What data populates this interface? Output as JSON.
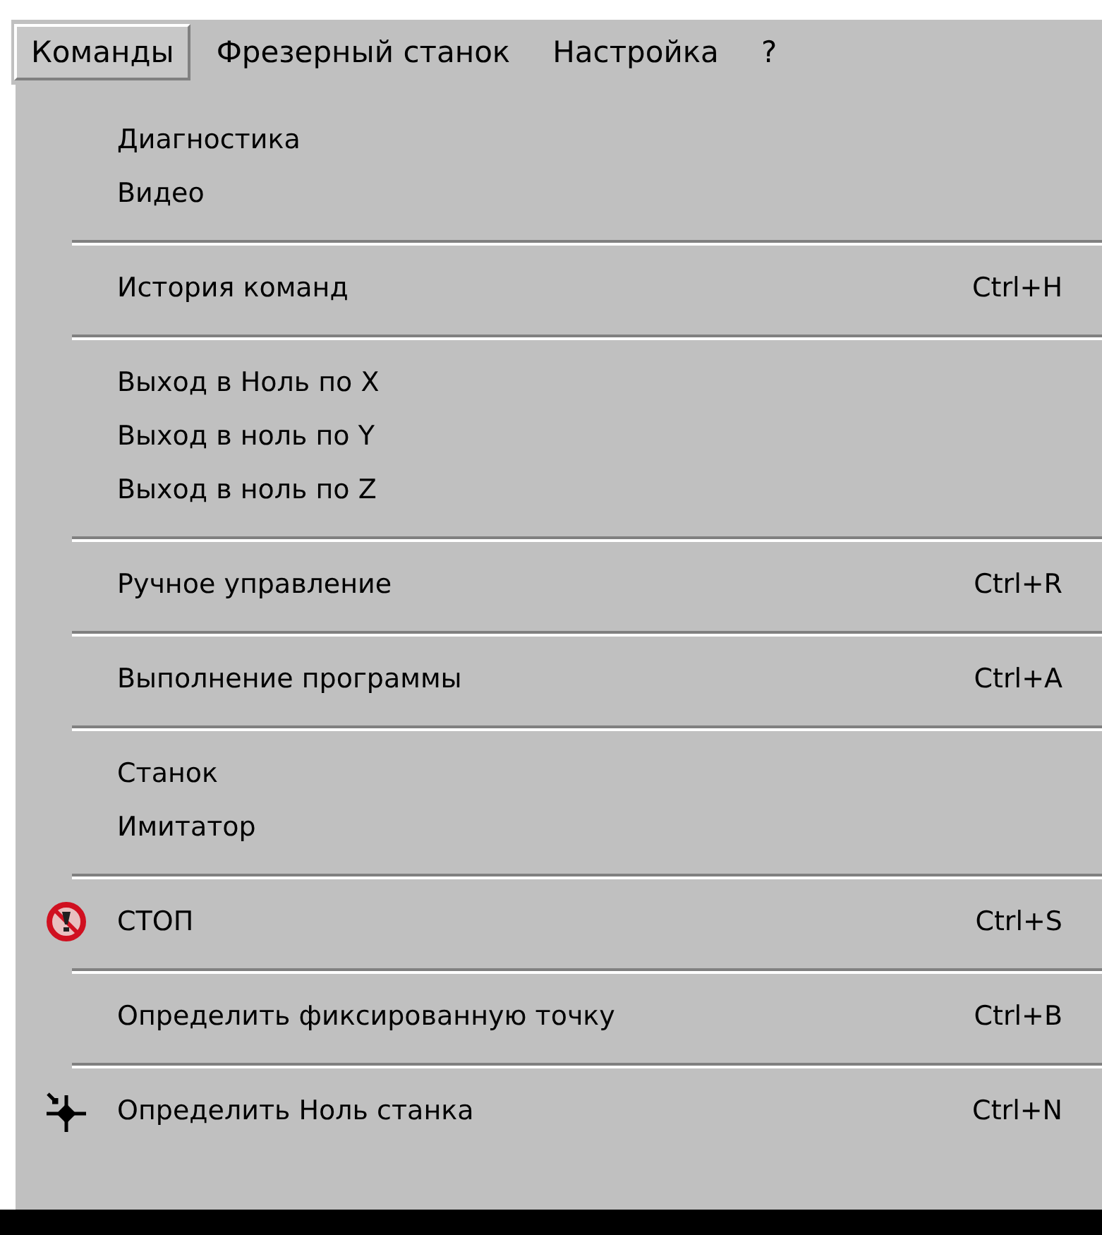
{
  "menubar": [
    {
      "label": "Команды",
      "selected": true
    },
    {
      "label": "Фрезерный станок",
      "selected": false
    },
    {
      "label": "Настройка",
      "selected": false
    },
    {
      "label": "?",
      "selected": false
    }
  ],
  "menu": {
    "groups": [
      [
        {
          "kind": "plain",
          "label": "Диагностика"
        },
        {
          "kind": "plain",
          "label": "Видео"
        }
      ],
      [
        {
          "kind": "plain",
          "label": "История команд",
          "shortcut": "Ctrl+H"
        }
      ],
      [
        {
          "kind": "plain",
          "label": "Выход в Ноль по X"
        },
        {
          "kind": "plain",
          "label": "Выход в ноль по Y"
        },
        {
          "kind": "plain",
          "label": "Выход в ноль по Z"
        }
      ],
      [
        {
          "kind": "plain",
          "label": "Ручное управление",
          "shortcut": "Ctrl+R"
        }
      ],
      [
        {
          "kind": "plain",
          "label": "Выполнение программы",
          "shortcut": "Ctrl+A"
        }
      ],
      [
        {
          "kind": "plain",
          "label": "Станок"
        },
        {
          "kind": "plain",
          "label": "Имитатор"
        }
      ],
      [
        {
          "kind": "stop",
          "label": "СТОП",
          "shortcut": "Ctrl+S"
        }
      ],
      [
        {
          "kind": "plain",
          "label": "Определить фиксированную точку",
          "shortcut": "Ctrl+B"
        }
      ],
      [
        {
          "kind": "origin",
          "label": "Определить Ноль станка",
          "shortcut": "Ctrl+N"
        }
      ]
    ]
  }
}
